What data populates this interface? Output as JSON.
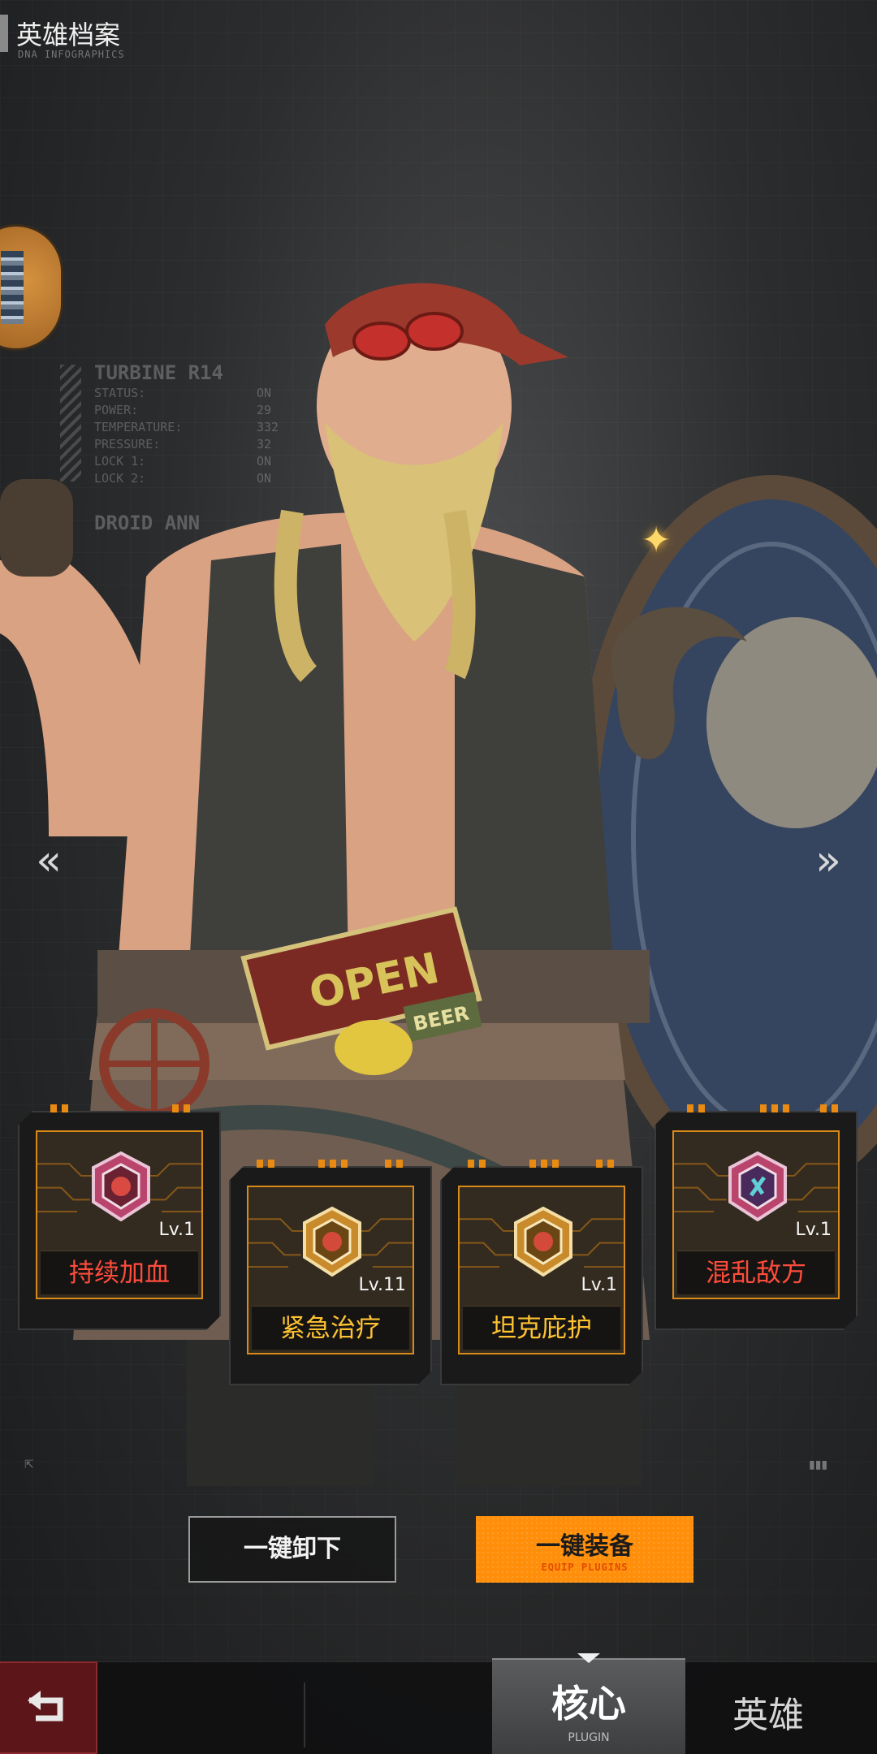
{
  "header": {
    "title": "英雄档案",
    "subtitle": "DNA INFOGRAPHICS"
  },
  "readout": {
    "title": "TURBINE R14",
    "rows": [
      {
        "label": "STATUS:",
        "value": "ON"
      },
      {
        "label": "POWER:",
        "value": "29"
      },
      {
        "label": "TEMPERATURE:",
        "value": "332"
      },
      {
        "label": "PRESSURE:",
        "value": "32"
      },
      {
        "label": "LOCK 1:",
        "value": "ON"
      },
      {
        "label": "LOCK 2:",
        "value": "ON"
      }
    ],
    "title2": "DROID ANN"
  },
  "nav": {
    "prev_icon": "double-chevron-left-icon",
    "next_icon": "double-chevron-right-icon"
  },
  "plugins": [
    {
      "name": "持续加血",
      "level": "Lv.1",
      "color": "#ff4c3b"
    },
    {
      "name": "紧急治疗",
      "level": "Lv.11",
      "color": "#ffc332"
    },
    {
      "name": "坦克庇护",
      "level": "Lv.1",
      "color": "#ffc332"
    },
    {
      "name": "混乱敌方",
      "level": "Lv.1",
      "color": "#ff4c3b"
    }
  ],
  "actions": {
    "unequip_label": "一键卸下",
    "equip_label": "一键装备",
    "equip_sub": "EQUIP PLUGINS"
  },
  "bottom": {
    "back_icon": "return-arrow-icon",
    "tab_core_label": "核心",
    "tab_core_sub": "PLUGIN",
    "tab_hero_label": "英雄"
  },
  "colors": {
    "accent": "#ff8f0a",
    "card_border": "#d98a18",
    "back_button": "#5c1518"
  }
}
